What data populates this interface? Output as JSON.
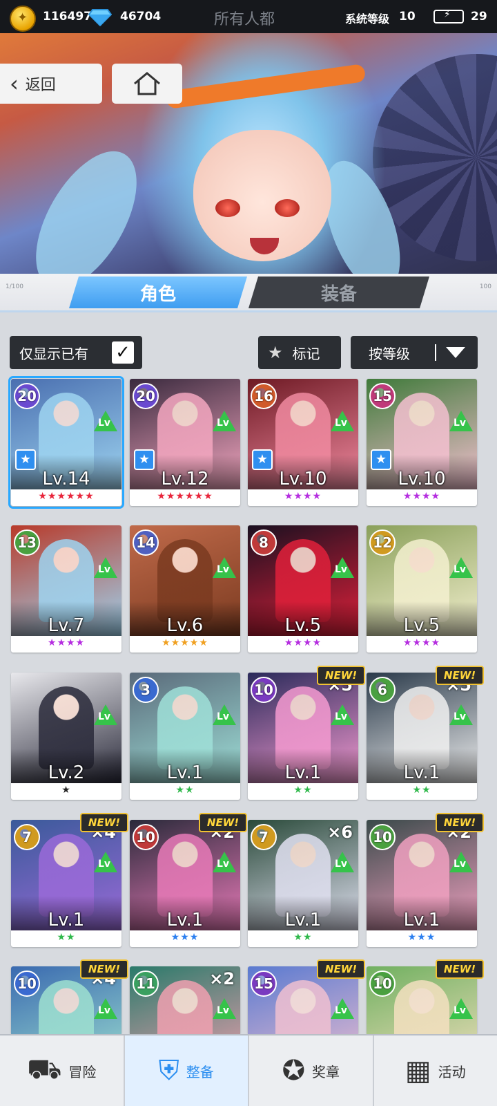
{
  "topbar": {
    "coins": "116497",
    "gems": "46704",
    "title": "所有人都",
    "system_level_label": "系统等级",
    "system_level": "10",
    "energy": "29"
  },
  "nav_buttons": {
    "back_label": "返回"
  },
  "tabs": {
    "role": "角色",
    "equipment": "装备"
  },
  "filters": {
    "owned_only_label": "仅显示已有",
    "owned_only_checked": true,
    "mark_label": "标记",
    "sort_label": "按等级"
  },
  "cards": [
    {
      "badge": "20",
      "level": "Lv.14",
      "stars": "★★★★★★",
      "star_color": "#e8243a",
      "favorite": true,
      "selected": true
    },
    {
      "badge": "20",
      "level": "Lv.12",
      "stars": "★★★★★★",
      "star_color": "#e8243a",
      "favorite": true
    },
    {
      "badge": "16",
      "level": "Lv.10",
      "stars": "★★★★",
      "star_color": "#b52de0",
      "favorite": true
    },
    {
      "badge": "15",
      "level": "Lv.10",
      "stars": "★★★★",
      "star_color": "#b52de0",
      "favorite": true
    },
    {
      "badge": "13",
      "level": "Lv.7",
      "stars": "★★★★",
      "star_color": "#b52de0"
    },
    {
      "badge": "14",
      "level": "Lv.6",
      "stars": "★★★★★",
      "star_color": "#f0a020"
    },
    {
      "badge": "8",
      "level": "Lv.5",
      "stars": "★★★★",
      "star_color": "#b52de0"
    },
    {
      "badge": "12",
      "level": "Lv.5",
      "stars": "★★★★",
      "star_color": "#b52de0"
    },
    {
      "badge": "",
      "level": "Lv.2",
      "stars": "★",
      "star_color": "#222222"
    },
    {
      "badge": "3",
      "level": "Lv.1",
      "stars": "★★",
      "star_color": "#2eb84a"
    },
    {
      "badge": "10",
      "level": "Lv.1",
      "stars": "★★",
      "star_color": "#2eb84a",
      "new": "NEW!",
      "mult": "×5"
    },
    {
      "badge": "6",
      "level": "Lv.1",
      "stars": "★★",
      "star_color": "#2eb84a",
      "new": "NEW!",
      "mult": "×5"
    },
    {
      "badge": "7",
      "level": "Lv.1",
      "stars": "★★",
      "star_color": "#2eb84a",
      "new": "NEW!",
      "mult": "×4"
    },
    {
      "badge": "10",
      "level": "Lv.1",
      "stars": "★★★",
      "star_color": "#2b7ff0",
      "new": "NEW!",
      "mult": "×2"
    },
    {
      "badge": "7",
      "level": "Lv.1",
      "stars": "★★",
      "star_color": "#2eb84a",
      "mult": "×6"
    },
    {
      "badge": "10",
      "level": "Lv.1",
      "stars": "★★★",
      "star_color": "#2b7ff0",
      "new": "NEW!",
      "mult": "×2"
    },
    {
      "badge": "10",
      "level": "",
      "stars": "",
      "new": "NEW!",
      "mult": "×4"
    },
    {
      "badge": "11",
      "level": "",
      "stars": "",
      "mult": "×2"
    },
    {
      "badge": "15",
      "level": "",
      "stars": "",
      "new": "NEW!"
    },
    {
      "badge": "10",
      "level": "",
      "stars": "",
      "new": "NEW!"
    }
  ],
  "bottom_nav": [
    {
      "label": "冒险",
      "icon": "truck-icon"
    },
    {
      "label": "整备",
      "icon": "armor-icon",
      "active": true
    },
    {
      "label": "奖章",
      "icon": "medal-icon"
    },
    {
      "label": "活动",
      "icon": "calendar-icon"
    }
  ]
}
